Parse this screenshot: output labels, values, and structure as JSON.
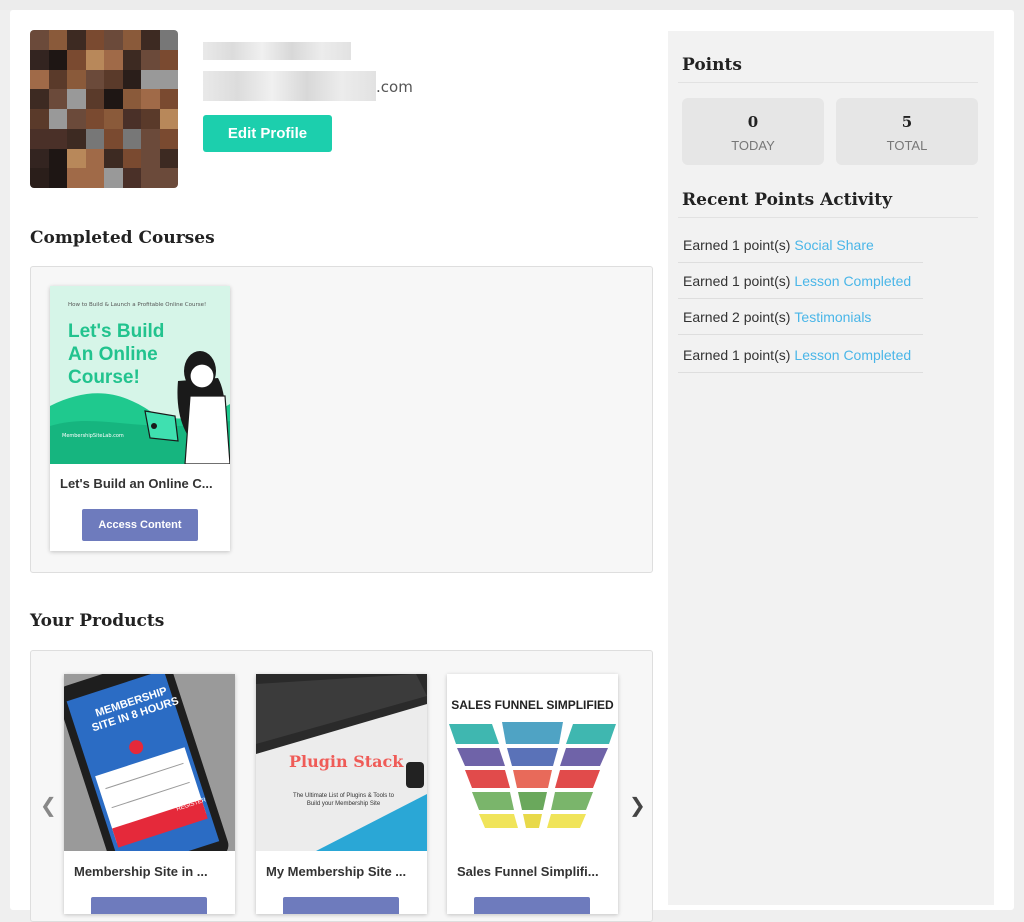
{
  "profile": {
    "email_suffix": ".com",
    "edit_label": "Edit Profile"
  },
  "completed": {
    "title": "Completed Courses",
    "course": {
      "thumb_small": "How to Build & Launch a Profitable Online Course!",
      "thumb_big": "Let's Build An Online Course!",
      "thumb_url": "MembershipSiteLab.com",
      "title": "Let's Build an Online C...",
      "button": "Access Content"
    }
  },
  "products": {
    "title": "Your Products",
    "prev": "❮",
    "next": "❯",
    "items": [
      {
        "title": "Membership Site in ...",
        "thumb_text": "MEMBERSHIP SITE IN 8 HOURS",
        "thumb_sub": "REGISTER"
      },
      {
        "title": "My Membership Site ...",
        "thumb_text": "Plugin Stack",
        "thumb_sub": "The Ultimate List of Plugins & Tools to Build your Membership Site"
      },
      {
        "title": "Sales Funnel Simplifi...",
        "thumb_text": "SALES FUNNEL SIMPLIFIED",
        "thumb_sub": ""
      }
    ]
  },
  "points": {
    "title": "Points",
    "today_value": "0",
    "today_label": "TODAY",
    "total_value": "5",
    "total_label": "TOTAL",
    "activity_title": "Recent Points Activity",
    "activity": [
      {
        "text": "Earned 1 point(s)",
        "link": "Social Share"
      },
      {
        "text": "Earned 1 point(s)",
        "link": "Lesson Completed"
      },
      {
        "text": "Earned 2 point(s)",
        "link": "Testimonials"
      },
      {
        "text": "Earned 1 point(s)",
        "link": "Lesson Completed"
      }
    ]
  },
  "colors": {
    "accent_green": "#1ccfad",
    "button_purple": "#6e7bbd",
    "link_blue": "#4ab6e8"
  }
}
